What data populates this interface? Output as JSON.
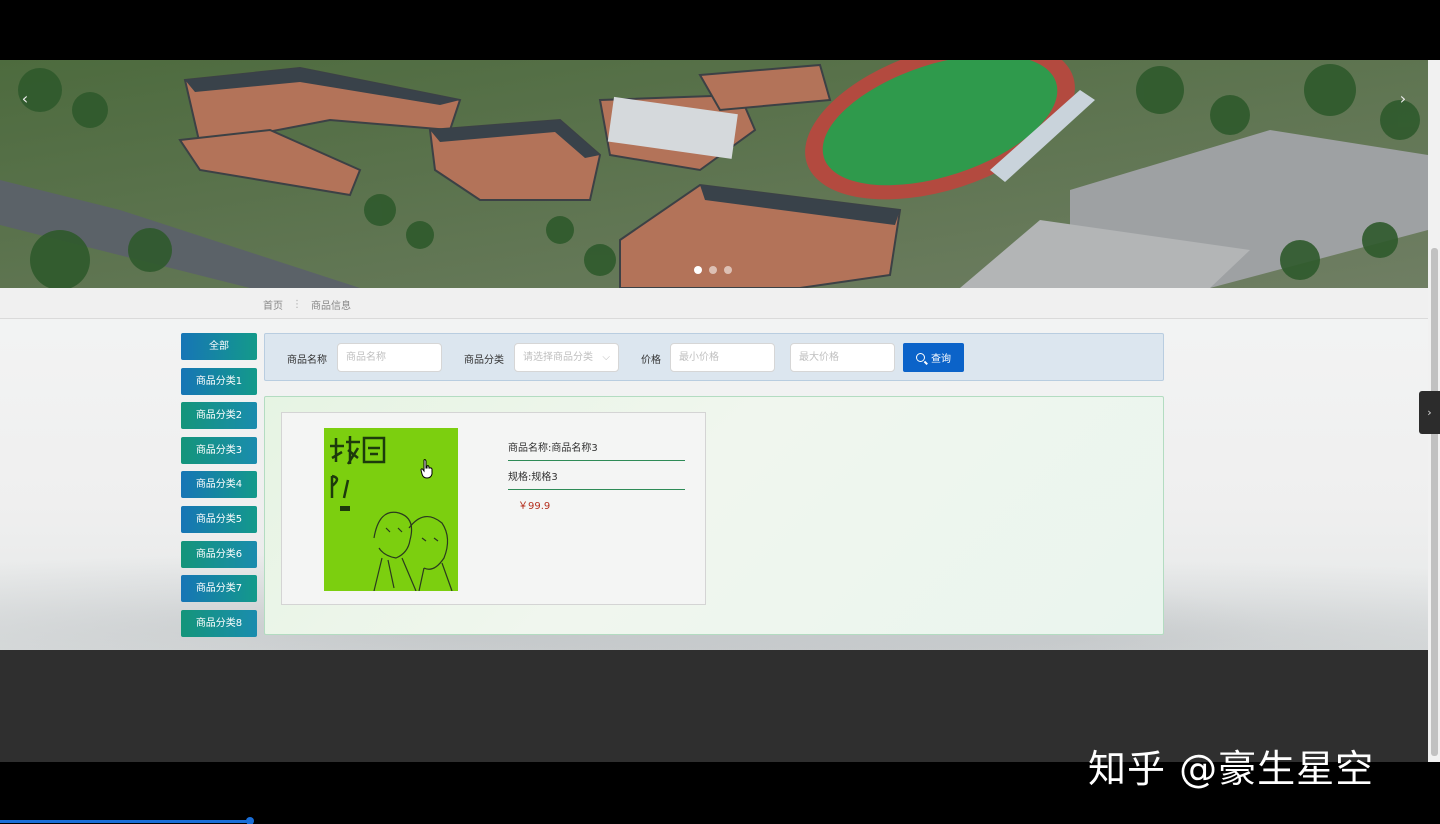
{
  "banner": {
    "prev_icon": "‹",
    "next_icon": "›",
    "slides": 3,
    "active_slide": 1
  },
  "breadcrumb": {
    "home": "首页",
    "separator": "⋮",
    "current": "商品信息"
  },
  "categories": [
    "全部",
    "商品分类1",
    "商品分类2",
    "商品分类3",
    "商品分类4",
    "商品分类5",
    "商品分类6",
    "商品分类7",
    "商品分类8"
  ],
  "search": {
    "name_label": "商品名称",
    "name_placeholder": "商品名称",
    "category_label": "商品分类",
    "category_placeholder": "请选择商品分类",
    "price_label": "价格",
    "min_price_placeholder": "最小价格",
    "max_price_placeholder": "最大价格",
    "button_label": "查询",
    "button_icon": "search-icon"
  },
  "products": [
    {
      "name": "商品名称:商品名称3",
      "spec": "规格:规格3",
      "price": "￥99.9"
    }
  ],
  "side_tab_icon": "›",
  "watermark": "知乎 @豪生星空",
  "colors": {
    "search_button": "#0b63c9",
    "category_gradient_start": "#1775b6",
    "category_gradient_end": "#139a8a",
    "price": "#b5301f",
    "footer": "#2f2f2f"
  }
}
